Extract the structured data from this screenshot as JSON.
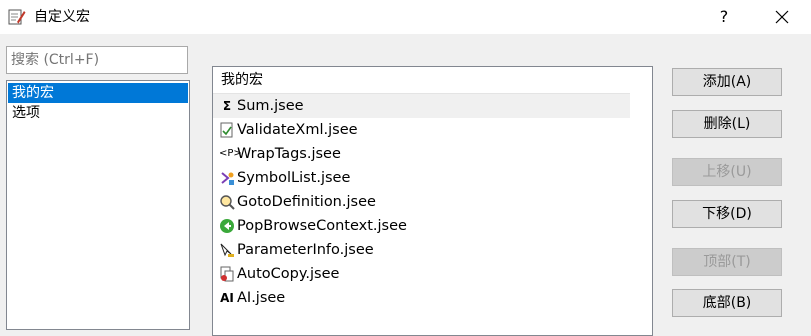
{
  "window": {
    "title": "自定义宏",
    "help_label": "?"
  },
  "search": {
    "placeholder": "搜索 (Ctrl+F)"
  },
  "categories": [
    {
      "label": "我的宏",
      "selected": true
    },
    {
      "label": "选项",
      "selected": false
    }
  ],
  "macros": {
    "header": "我的宏",
    "items": [
      {
        "label": "Sum.jsee",
        "icon": "sigma-icon"
      },
      {
        "label": "ValidateXml.jsee",
        "icon": "document-check-icon"
      },
      {
        "label": "WrapTags.jsee",
        "icon": "tags-icon"
      },
      {
        "label": "SymbolList.jsee",
        "icon": "symbols-icon"
      },
      {
        "label": "GotoDefinition.jsee",
        "icon": "magnifier-icon"
      },
      {
        "label": "PopBrowseContext.jsee",
        "icon": "back-arrow-icon"
      },
      {
        "label": "ParameterInfo.jsee",
        "icon": "parameter-icon"
      },
      {
        "label": "AutoCopy.jsee",
        "icon": "copy-icon"
      },
      {
        "label": "AI.jsee",
        "icon": "ai-icon"
      }
    ]
  },
  "buttons": {
    "add": "添加(A)",
    "delete": "删除(L)",
    "move_up": "上移(U)",
    "move_down": "下移(D)",
    "top": "顶部(T)",
    "bottom": "底部(B)"
  },
  "colors": {
    "selection": "#0078d7",
    "window_bg": "#f0f0f0"
  }
}
